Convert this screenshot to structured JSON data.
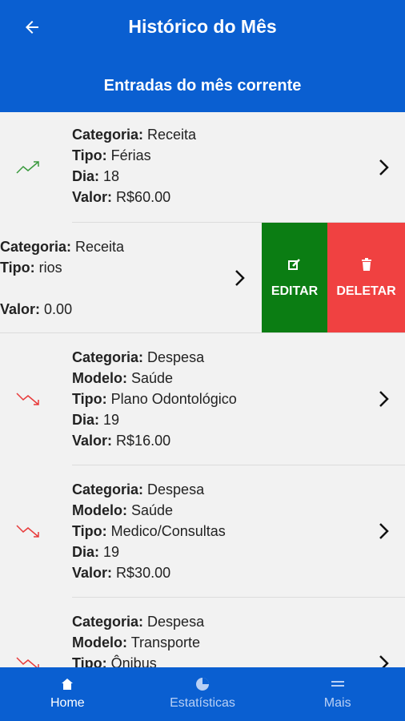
{
  "header": {
    "title": "Histórico do Mês",
    "subtitle": "Entradas do mês corrente",
    "back_icon": "arrow-left-icon"
  },
  "labels": {
    "categoria": "Categoria:",
    "modelo": "Modelo:",
    "tipo": "Tipo:",
    "dia": "Dia:",
    "valor": "Valor:"
  },
  "entries": [
    {
      "categoria": "Receita",
      "tipo": "Férias",
      "dia": "18",
      "valor": "R$60.00",
      "trend": "up"
    },
    {
      "categoria": "Receita",
      "tipo": "rios",
      "valor": "0.00",
      "trend": "up"
    },
    {
      "categoria": "Despesa",
      "modelo": "Saúde",
      "tipo": "Plano Odontológico",
      "dia": "19",
      "valor": "R$16.00",
      "trend": "down"
    },
    {
      "categoria": "Despesa",
      "modelo": "Saúde",
      "tipo": "Medico/Consultas",
      "dia": "19",
      "valor": "R$30.00",
      "trend": "down"
    },
    {
      "categoria": "Despesa",
      "modelo": "Transporte",
      "tipo": "Ônibus",
      "trend": "down"
    }
  ],
  "swipe_actions": {
    "edit_label": "EDITAR",
    "delete_label": "DELETAR",
    "edit_color": "#0b7d13",
    "delete_color": "#f04141"
  },
  "colors": {
    "primary": "#0a5fd1",
    "trend_up": "#3a9a3e",
    "trend_down": "#e83a3a"
  },
  "bottom_nav": [
    {
      "label": "Home",
      "icon": "home-icon",
      "active": true
    },
    {
      "label": "Estatísticas",
      "icon": "pie-chart-icon",
      "active": false
    },
    {
      "label": "Mais",
      "icon": "menu-icon",
      "active": false
    }
  ]
}
